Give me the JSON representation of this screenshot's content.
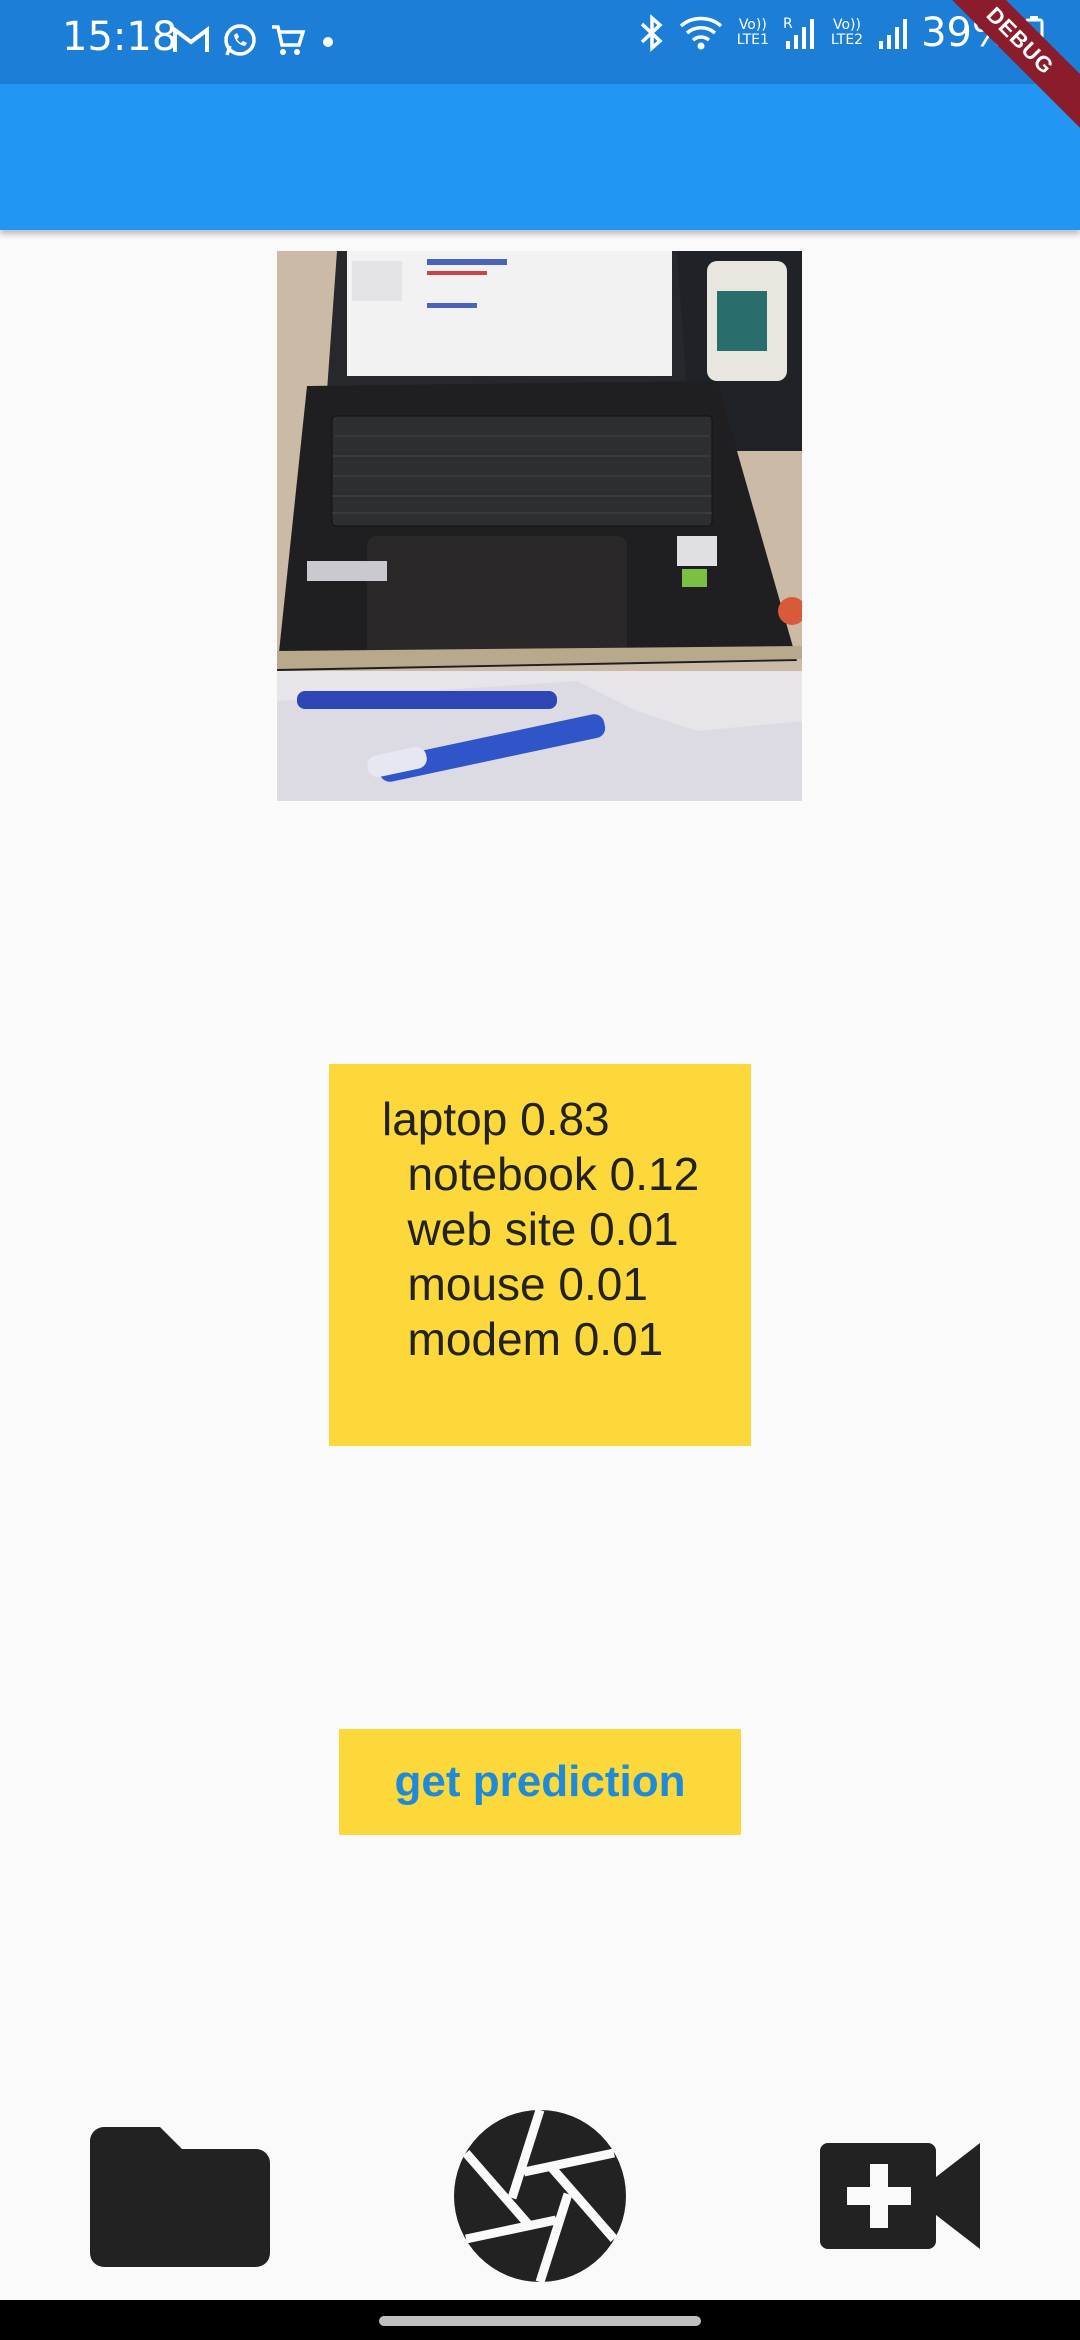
{
  "status_bar": {
    "time": "15:18",
    "battery": "39%",
    "net1": {
      "top": "Vo))",
      "bottom": "LTE1"
    },
    "net2": {
      "top": "Vo))",
      "bottom": "LTE2"
    },
    "roaming": "R"
  },
  "debug_banner": "DEBUG",
  "prediction": {
    "lines": [
      "laptop 0.83",
      "  notebook 0.12",
      "  web site 0.01",
      "  mouse 0.01",
      "  modem 0.01"
    ]
  },
  "predict_button_label": "get prediction",
  "bottom_actions": [
    {
      "icon": "folder-icon"
    },
    {
      "icon": "camera-shutter-icon"
    },
    {
      "icon": "video-add-icon"
    }
  ],
  "colors": {
    "status_bar": "#1c7ed6",
    "app_bar": "#2196f3",
    "accent_yellow": "#fdd83b",
    "button_text": "#1f8ad8",
    "debug_banner": "#8b1c2b"
  }
}
